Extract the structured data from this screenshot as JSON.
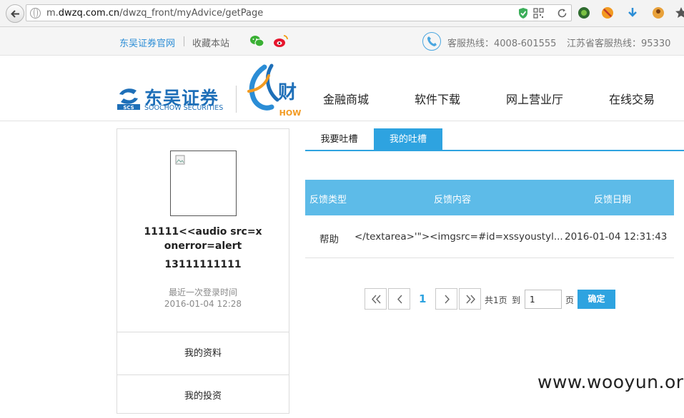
{
  "browser": {
    "url_prefix": "m.",
    "url_domain": "dwzq.com.cn",
    "url_path": "/dwzq_front/myAdvice/getPage"
  },
  "topbar": {
    "official_site": "东吴证券官网",
    "favorite": "收藏本站",
    "hotline": "客服热线：4008-601555",
    "hotline_jiangsu": "江苏省客服热线：95330"
  },
  "header": {
    "logo_cn": "东吴证券",
    "logo_en": "SOOCHOW SECURITIES",
    "logo_mark": "SCS",
    "caifu_logo_text": "财",
    "caifu_logo_sub": "HOW",
    "nav": [
      "金融商城",
      "软件下载",
      "网上营业厅",
      "在线交易"
    ]
  },
  "sidebar": {
    "username": "11111<<audio src=x onerror=alert",
    "phone": "13111111111",
    "last_login_label": "最近一次登录时间",
    "last_login_time": "2016-01-04 12:28",
    "items": [
      "我的资料",
      "我的投资"
    ]
  },
  "tabs": {
    "write": "我要吐槽",
    "mine": "我的吐槽"
  },
  "table": {
    "headers": [
      "反馈类型",
      "反馈内容",
      "反馈日期"
    ],
    "rows": [
      [
        "帮助",
        "</textarea>'\"><imgsrc=#id=xssyoustyl...",
        "2016-01-04 12:31:43"
      ]
    ]
  },
  "pager": {
    "current": "1",
    "total": "共1页",
    "to": "到",
    "input_value": "1",
    "unit": "页",
    "confirm": "确定"
  },
  "watermark": "www.wooyun.org",
  "colors": {
    "accent": "#2ea3e0",
    "table_header": "#5dbbe8",
    "brand": "#1e6fb8"
  }
}
